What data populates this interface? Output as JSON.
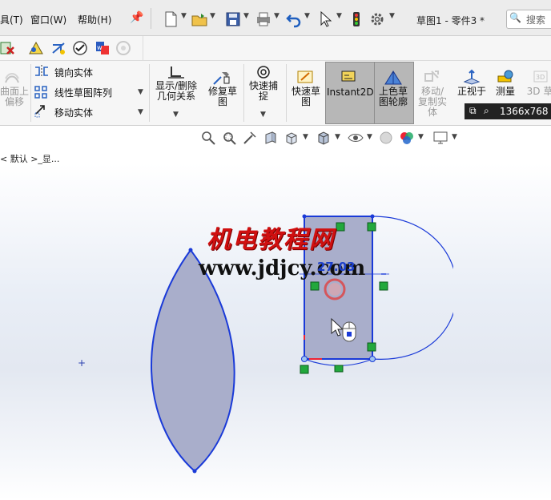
{
  "menubar": {
    "items": [
      "具(T)",
      "窗口(W)",
      "帮助(H)"
    ],
    "doc_title": "草图1 - 零件3 *",
    "search_placeholder": "搜索"
  },
  "cm_row1": {
    "icons": [
      "display-delete-icon",
      "relations-icon",
      "check-icon",
      "report-icon",
      "disabled-icon"
    ]
  },
  "cm_row2": {
    "left_partial": [
      "曲面上",
      "偏移"
    ],
    "mirror_label": "镜向实体",
    "pattern_label": "线性草图阵列",
    "move_label": "移动实体",
    "show_delete_label": [
      "显示/删除",
      "几何关系"
    ],
    "repair_label": [
      "修复草",
      "图"
    ],
    "quicksnap_label": [
      "快速捕",
      "捉"
    ],
    "rapid_sketch_label": [
      "快速草",
      "图"
    ],
    "instant2d_label": "Instant2D",
    "shaded_label": [
      "上色草",
      "图轮廓"
    ],
    "move_copy_label": [
      "移动/",
      "复制实",
      "体"
    ],
    "normal_to_label": "正视于",
    "measure_label": "测量",
    "threed_label": "3D 草"
  },
  "badge": {
    "resolution": "1366x768"
  },
  "graphics": {
    "breadcrumb": "< 默认 >_显...",
    "watermark_cn": "机电教程网",
    "watermark_url": "www.jdjcy.com",
    "dimension": "27.03"
  },
  "colors": {
    "sketch_line": "#1a3ad8",
    "shape_fill": "#a9aecb",
    "relation_marker": "#22a83c",
    "watermark_red": "#d01010"
  }
}
